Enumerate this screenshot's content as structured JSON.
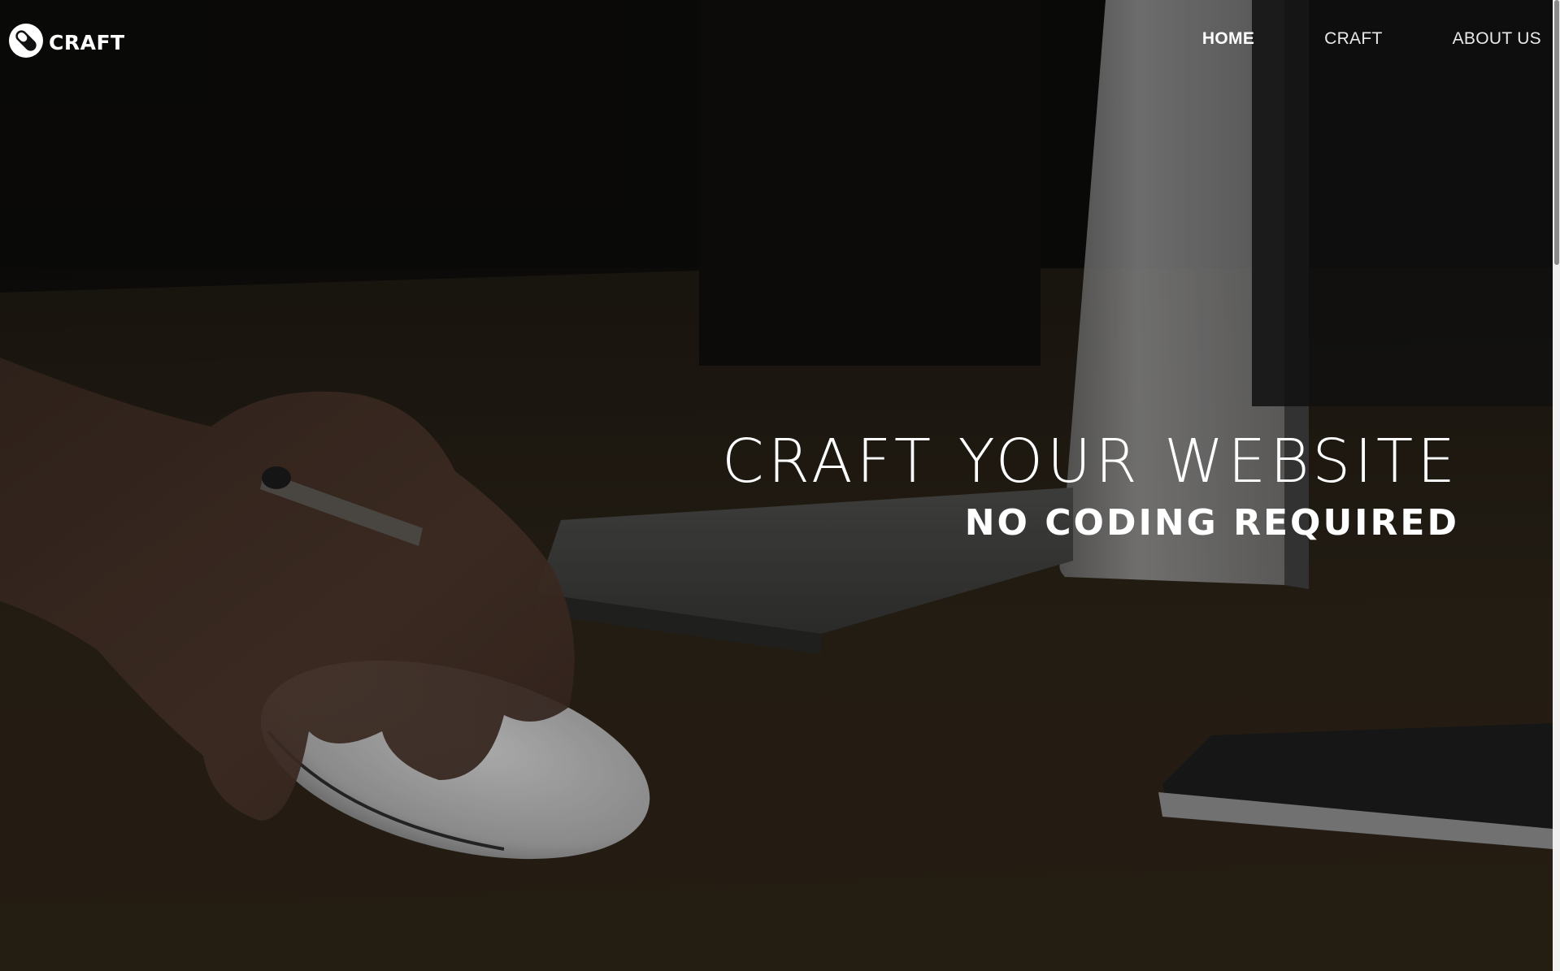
{
  "brand": {
    "logo_text": "CRAFT",
    "logo_icon": "pill-capsule-icon"
  },
  "nav": {
    "items": [
      {
        "label": "HOME",
        "active": true
      },
      {
        "label": "CRAFT",
        "active": false
      },
      {
        "label": "ABOUT US",
        "active": false
      }
    ]
  },
  "hero": {
    "title": "CRAFT YOUR WEBSITE",
    "subtitle": "NO CODING REQUIRED"
  },
  "colors": {
    "text": "#ffffff",
    "background_dark": "#0d0c0a",
    "desk_wood": "#2c2315"
  }
}
